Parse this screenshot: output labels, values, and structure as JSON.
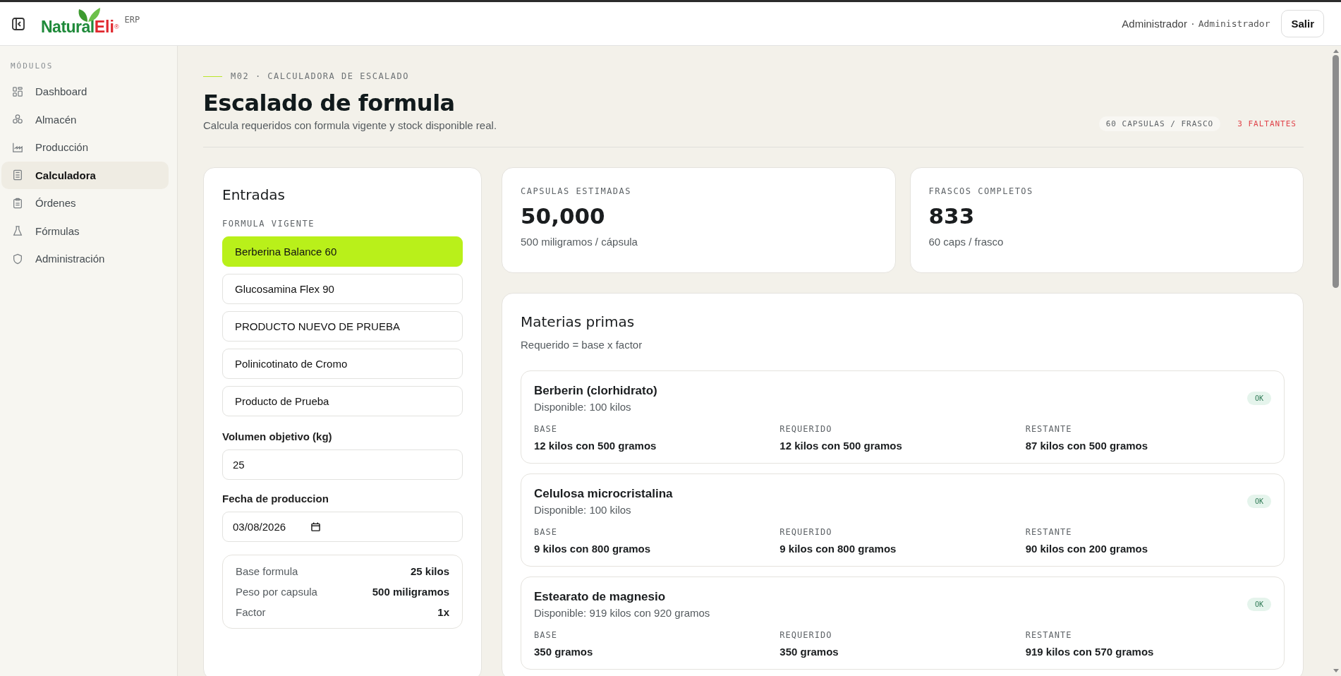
{
  "header": {
    "logo": {
      "part_1": "Natural",
      "part_2": "Eli",
      "mark": "®"
    },
    "suffix": "ERP",
    "user_name": "Administrador",
    "separator": "·",
    "user_role": "Administrador",
    "logout": "Salir"
  },
  "sidebar": {
    "heading": "MÓDULOS",
    "items": [
      {
        "label": "Dashboard",
        "selected": false
      },
      {
        "label": "Almacén",
        "selected": false
      },
      {
        "label": "Producción",
        "selected": false
      },
      {
        "label": "Calculadora",
        "selected": true
      },
      {
        "label": "Órdenes",
        "selected": false
      },
      {
        "label": "Fórmulas",
        "selected": false
      },
      {
        "label": "Administración",
        "selected": false
      }
    ]
  },
  "page": {
    "breadcrumb": "M02 · CALCULADORA DE ESCALADO",
    "title": "Escalado de formula",
    "subtitle": "Calcula requeridos con formula vigente y stock disponible real.",
    "tags": [
      {
        "label": "60 CAPSULAS / FRASCO",
        "kind": "neutral"
      },
      {
        "label": "3 FALTANTES",
        "kind": "alert"
      }
    ]
  },
  "inputs": {
    "title": "Entradas",
    "formula_label": "FORMULA VIGENTE",
    "formulas": [
      {
        "label": "Berberina Balance 60",
        "selected": true
      },
      {
        "label": "Glucosamina Flex 90",
        "selected": false
      },
      {
        "label": "PRODUCTO NUEVO DE PRUEBA",
        "selected": false
      },
      {
        "label": "Polinicotinato de Cromo",
        "selected": false
      },
      {
        "label": "Producto de Prueba",
        "selected": false
      }
    ],
    "volume_label": "Volumen objetivo (kg)",
    "volume_value": "25",
    "date_label": "Fecha de produccion",
    "date_value": "03/08/2026",
    "summary": [
      {
        "label": "Base formula",
        "value": "25 kilos"
      },
      {
        "label": "Peso por capsula",
        "value": "500 miligramos"
      },
      {
        "label": "Factor",
        "value": "1x"
      }
    ]
  },
  "stats": [
    {
      "label": "CAPSULAS ESTIMADAS",
      "value": "50,000",
      "note": "500 miligramos / cápsula"
    },
    {
      "label": "FRASCOS COMPLETOS",
      "value": "833",
      "note": "60 caps / frasco"
    }
  ],
  "materials": {
    "title": "Materias primas",
    "subtitle": "Requerido = base x factor",
    "items": [
      {
        "name": "Berberin (clorhidrato)",
        "available": "Disponible: 100 kilos",
        "status": "OK",
        "columns": [
          {
            "label": "BASE",
            "value": "12 kilos con 500 gramos"
          },
          {
            "label": "REQUERIDO",
            "value": "12 kilos con 500 gramos"
          },
          {
            "label": "RESTANTE",
            "value": "87 kilos con 500 gramos"
          }
        ]
      },
      {
        "name": "Celulosa microcristalina",
        "available": "Disponible: 100 kilos",
        "status": "OK",
        "columns": [
          {
            "label": "BASE",
            "value": "9 kilos con 800 gramos"
          },
          {
            "label": "REQUERIDO",
            "value": "9 kilos con 800 gramos"
          },
          {
            "label": "RESTANTE",
            "value": "90 kilos con 200 gramos"
          }
        ]
      },
      {
        "name": "Estearato de magnesio",
        "available": "Disponible: 919 kilos con 920 gramos",
        "status": "OK",
        "columns": [
          {
            "label": "BASE",
            "value": "350 gramos"
          },
          {
            "label": "REQUERIDO",
            "value": "350 gramos"
          },
          {
            "label": "RESTANTE",
            "value": "919 kilos con 570 gramos"
          }
        ]
      }
    ]
  }
}
